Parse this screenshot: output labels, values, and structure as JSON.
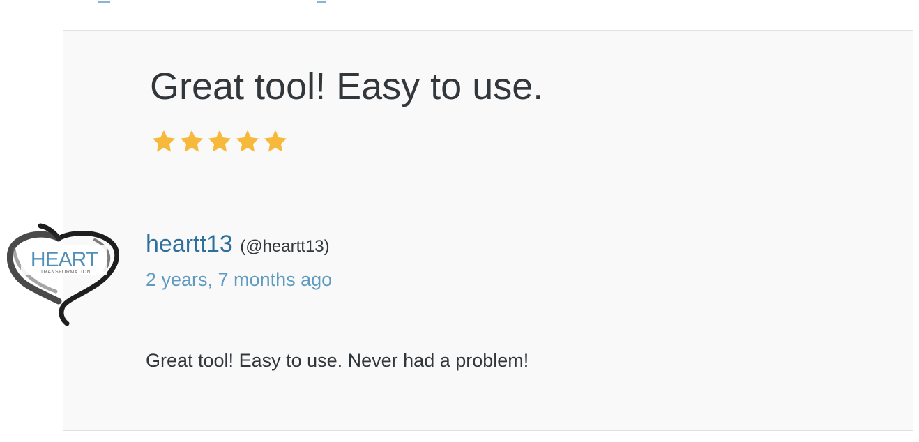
{
  "review": {
    "title": "Great tool! Easy to use.",
    "rating": 5,
    "rating_max": 5,
    "star_color": "#f6b93b",
    "author": {
      "display_name": "heartt13",
      "handle": "(@heartt13)",
      "avatar_logo_text": "HEART",
      "avatar_logo_subtext": "TRANSFORMATION"
    },
    "date": "2 years, 7 months ago",
    "body": "Great tool! Easy to use. Never had a problem!"
  },
  "colors": {
    "card_background": "#f9f9f9",
    "card_border": "#e2e2e2",
    "link": "#2f6f9b",
    "date_link": "#5f9bc0",
    "text": "#32373c"
  },
  "icons": {
    "rating_star": "star-icon",
    "avatar": "heart-transformation-logo"
  }
}
